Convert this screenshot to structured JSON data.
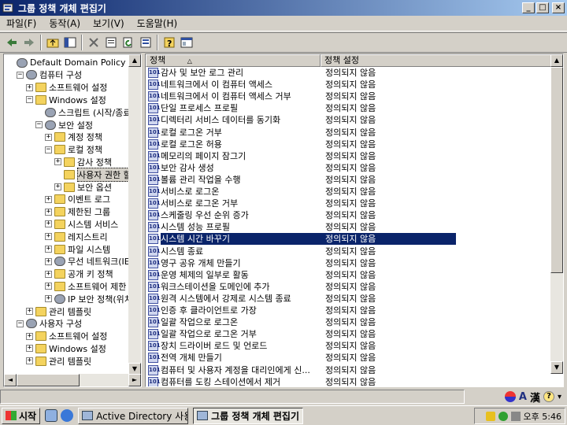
{
  "window": {
    "title": "그룹 정책 개체 편집기",
    "controls": {
      "minimize": "_",
      "maximize": "□",
      "close": "×"
    }
  },
  "menu": [
    "파일(F)",
    "동작(A)",
    "보기(V)",
    "도움말(H)"
  ],
  "toolbar": {
    "icons": [
      "back-icon",
      "forward-icon",
      "up-folder-icon",
      "show-hide-tree-icon",
      "delete-icon",
      "properties-icon",
      "refresh-icon",
      "export-list-icon",
      "help-icon",
      "console-icon"
    ]
  },
  "tree": [
    {
      "label": "Default Domain Policy [win20",
      "level": 0,
      "expander": "",
      "icon": "policy-icon"
    },
    {
      "label": "컴퓨터 구성",
      "level": 1,
      "expander": "−",
      "icon": "computer-icon"
    },
    {
      "label": "소프트웨어 설정",
      "level": 2,
      "expander": "+",
      "icon": "folder-icon"
    },
    {
      "label": "Windows 설정",
      "level": 2,
      "expander": "−",
      "icon": "folder-icon"
    },
    {
      "label": "스크립트 (시작/종료",
      "level": 3,
      "expander": "",
      "icon": "script-icon"
    },
    {
      "label": "보안 설정",
      "level": 3,
      "expander": "−",
      "icon": "security-icon"
    },
    {
      "label": "계정 정책",
      "level": 4,
      "expander": "+",
      "icon": "folder-icon"
    },
    {
      "label": "로컬 정책",
      "level": 4,
      "expander": "−",
      "icon": "folder-icon"
    },
    {
      "label": "감사 정책",
      "level": 5,
      "expander": "+",
      "icon": "folder-icon"
    },
    {
      "label": "사용자 권한 할",
      "level": 5,
      "expander": "",
      "icon": "folder-icon",
      "selected": true
    },
    {
      "label": "보안 옵션",
      "level": 5,
      "expander": "+",
      "icon": "folder-icon"
    },
    {
      "label": "이벤트 로그",
      "level": 4,
      "expander": "+",
      "icon": "folder-icon"
    },
    {
      "label": "제한된 그룹",
      "level": 4,
      "expander": "+",
      "icon": "folder-icon"
    },
    {
      "label": "시스템 서비스",
      "level": 4,
      "expander": "+",
      "icon": "folder-icon"
    },
    {
      "label": "레지스트리",
      "level": 4,
      "expander": "+",
      "icon": "folder-icon"
    },
    {
      "label": "파일 시스템",
      "level": 4,
      "expander": "+",
      "icon": "folder-icon"
    },
    {
      "label": "무선 네트워크(IE",
      "level": 4,
      "expander": "+",
      "icon": "antenna-icon"
    },
    {
      "label": "공개 키 정책",
      "level": 4,
      "expander": "+",
      "icon": "folder-icon"
    },
    {
      "label": "소프트웨어 제한",
      "level": 4,
      "expander": "+",
      "icon": "folder-icon"
    },
    {
      "label": "IP 보안 정책(위치",
      "level": 4,
      "expander": "+",
      "icon": "ip-security-icon"
    },
    {
      "label": "관리 템플릿",
      "level": 2,
      "expander": "+",
      "icon": "folder-icon"
    },
    {
      "label": "사용자 구성",
      "level": 1,
      "expander": "−",
      "icon": "user-icon"
    },
    {
      "label": "소프트웨어 설정",
      "level": 2,
      "expander": "+",
      "icon": "folder-icon"
    },
    {
      "label": "Windows 설정",
      "level": 2,
      "expander": "+",
      "icon": "folder-icon"
    },
    {
      "label": "관리 템플릿",
      "level": 2,
      "expander": "+",
      "icon": "folder-icon"
    }
  ],
  "columns": {
    "policy": "정책",
    "policy_sort": "△",
    "setting": "정책 설정"
  },
  "policies": [
    {
      "name": "감사 및 보안 로그 관리",
      "setting": "정의되지 않음"
    },
    {
      "name": "네트워크에서 이 컴퓨터 액세스",
      "setting": "정의되지 않음"
    },
    {
      "name": "네트워크에서 이 컴퓨터 액세스 거부",
      "setting": "정의되지 않음"
    },
    {
      "name": "단일 프로세스 프로필",
      "setting": "정의되지 않음"
    },
    {
      "name": "디렉터리 서비스 데이터를 동기화",
      "setting": "정의되지 않음"
    },
    {
      "name": "로컬 로그온 거부",
      "setting": "정의되지 않음"
    },
    {
      "name": "로컬 로그온 허용",
      "setting": "정의되지 않음"
    },
    {
      "name": "메모리의 페이지 잠그기",
      "setting": "정의되지 않음"
    },
    {
      "name": "보안 감사 생성",
      "setting": "정의되지 않음"
    },
    {
      "name": "볼륨 관리 작업을 수행",
      "setting": "정의되지 않음"
    },
    {
      "name": "서비스로 로그온",
      "setting": "정의되지 않음"
    },
    {
      "name": "서비스로 로그온 거부",
      "setting": "정의되지 않음"
    },
    {
      "name": "스케줄링 우선 순위 증가",
      "setting": "정의되지 않음"
    },
    {
      "name": "시스템 성능 프로필",
      "setting": "정의되지 않음"
    },
    {
      "name": "시스템 시간 바꾸기",
      "setting": "정의되지 않음",
      "selected": true
    },
    {
      "name": "시스템 종료",
      "setting": "정의되지 않음"
    },
    {
      "name": "영구 공유 개체 만들기",
      "setting": "정의되지 않음"
    },
    {
      "name": "운영 체제의 일부로 활동",
      "setting": "정의되지 않음"
    },
    {
      "name": "워크스테이션을 도메인에 추가",
      "setting": "정의되지 않음"
    },
    {
      "name": "원격 시스템에서 강제로 시스템 종료",
      "setting": "정의되지 않음"
    },
    {
      "name": "인증 후 클라이언트로 가장",
      "setting": "정의되지 않음"
    },
    {
      "name": "일괄 작업으로 로그온",
      "setting": "정의되지 않음"
    },
    {
      "name": "일괄 작업으로 로그온 거부",
      "setting": "정의되지 않음"
    },
    {
      "name": "장치 드라이버 로드 및 언로드",
      "setting": "정의되지 않음"
    },
    {
      "name": "전역 개체 만들기",
      "setting": "정의되지 않음"
    },
    {
      "name": "컴퓨터 및 사용자 계정을 대리인에게 신...",
      "setting": "정의되지 않음"
    },
    {
      "name": "컴퓨터를 도킹 스테이션에서 제거",
      "setting": "정의되지 않음"
    }
  ],
  "ime": {
    "mode": "A",
    "hanja": "漢"
  },
  "taskbar": {
    "start": "시작",
    "tasks": [
      {
        "label": "Active Directory 사용...",
        "active": false
      },
      {
        "label": "그룹 정책 개체 편집기",
        "active": true
      }
    ],
    "clock": "오후 5:46"
  }
}
